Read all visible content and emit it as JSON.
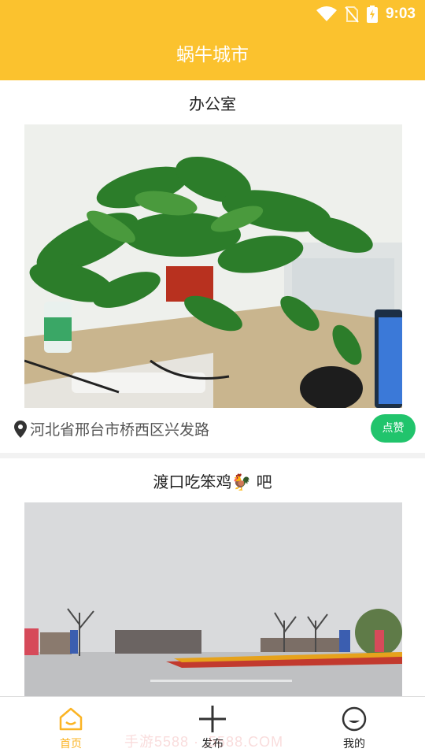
{
  "status": {
    "time": "9:03",
    "icons": [
      "wifi-icon",
      "no-sim-icon",
      "battery-charging-icon"
    ]
  },
  "app": {
    "title": "蜗牛城市"
  },
  "posts": [
    {
      "title": "办公室",
      "image": "office-desk-plant-photo",
      "location": "河北省邢台市桥西区兴发路",
      "like_label": "点赞"
    },
    {
      "title": "渡口吃笨鸡🐓 吧",
      "image": "outdoor-flower-garden-photo"
    }
  ],
  "tabbar": {
    "tabs": [
      {
        "label": "首页",
        "icon": "home-icon",
        "active": true
      },
      {
        "label": "发布",
        "icon": "plus-icon",
        "active": false
      },
      {
        "label": "我的",
        "icon": "profile-icon",
        "active": false
      }
    ]
  },
  "watermark": "手游5588 · .5588.COM",
  "colors": {
    "brand": "#fbc22e",
    "like": "#21c46c",
    "tab_active": "#fbb424"
  }
}
